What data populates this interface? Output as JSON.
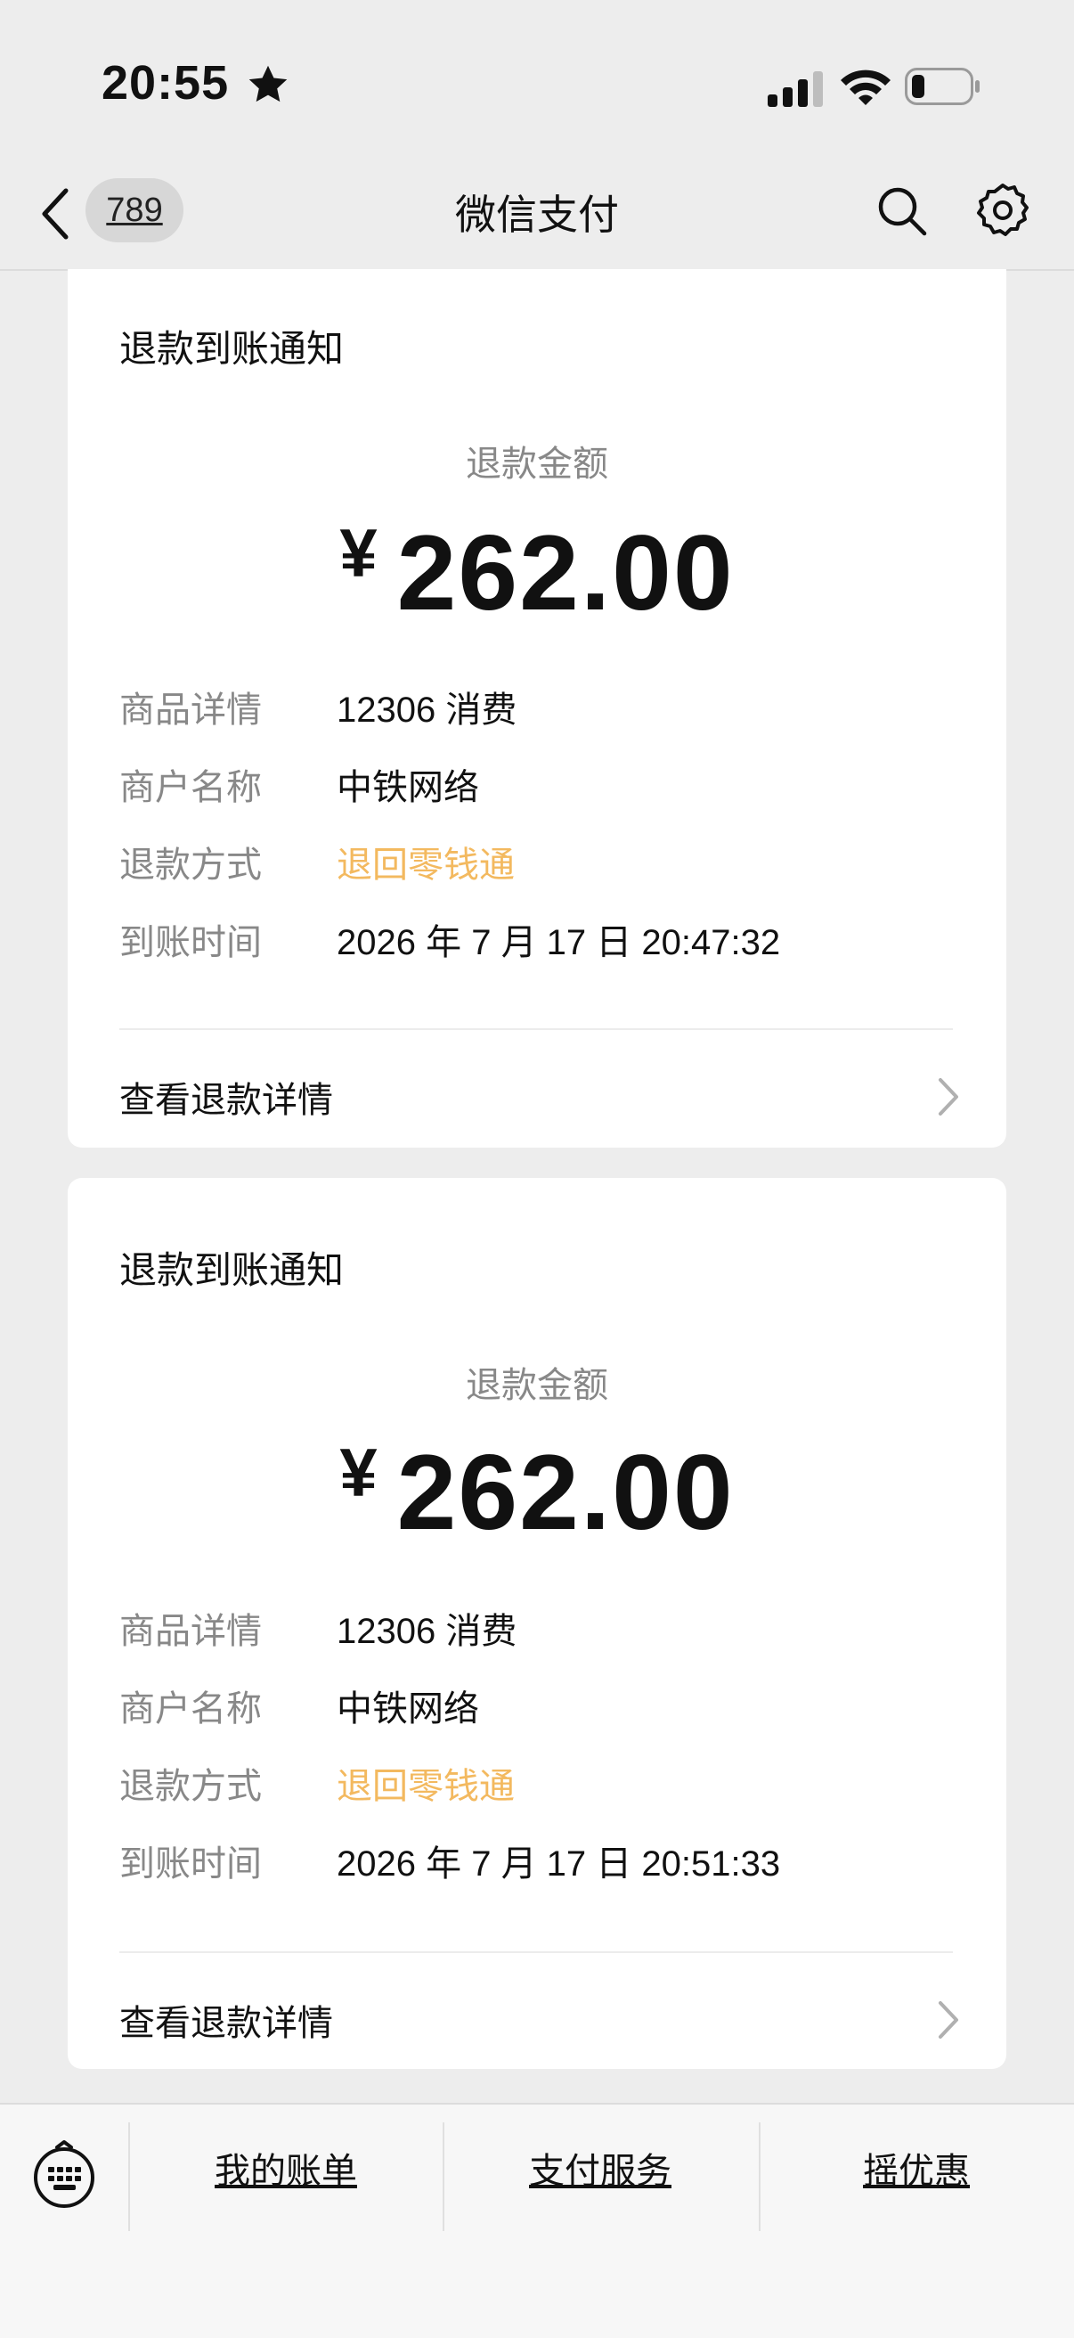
{
  "status_bar": {
    "time": "20:55"
  },
  "nav": {
    "back_badge": "789",
    "title": "微信支付"
  },
  "colors": {
    "accent": "#f3b95f",
    "background": "#ededed",
    "muted": "#888888"
  },
  "cards": [
    {
      "title": "退款到账通知",
      "amount_label": "退款金额",
      "currency": "¥",
      "amount": "262.00",
      "rows": [
        {
          "label": "商品详情",
          "value": "12306 消费"
        },
        {
          "label": "商户名称",
          "value": "中铁网络"
        },
        {
          "label": "退款方式",
          "value": "退回零钱通"
        },
        {
          "label": "到账时间",
          "value": "2026 年 7 月 17 日  20:47:32"
        }
      ],
      "detail_link": "查看退款详情"
    },
    {
      "title": "退款到账通知",
      "amount_label": "退款金额",
      "currency": "¥",
      "amount": "262.00",
      "rows": [
        {
          "label": "商品详情",
          "value": "12306 消费"
        },
        {
          "label": "商户名称",
          "value": "中铁网络"
        },
        {
          "label": "退款方式",
          "value": "退回零钱通"
        },
        {
          "label": "到账时间",
          "value": "2026 年 7 月 17 日  20:51:33"
        }
      ],
      "detail_link": "查看退款详情"
    }
  ],
  "bottom_menu": {
    "items": [
      "我的账单",
      "支付服务",
      "摇优惠"
    ]
  },
  "icons": [
    "star-icon",
    "signal-icon",
    "wifi-icon",
    "battery-icon",
    "back-icon",
    "search-icon",
    "gear-icon",
    "chevron-right-icon",
    "keyboard-icon"
  ]
}
